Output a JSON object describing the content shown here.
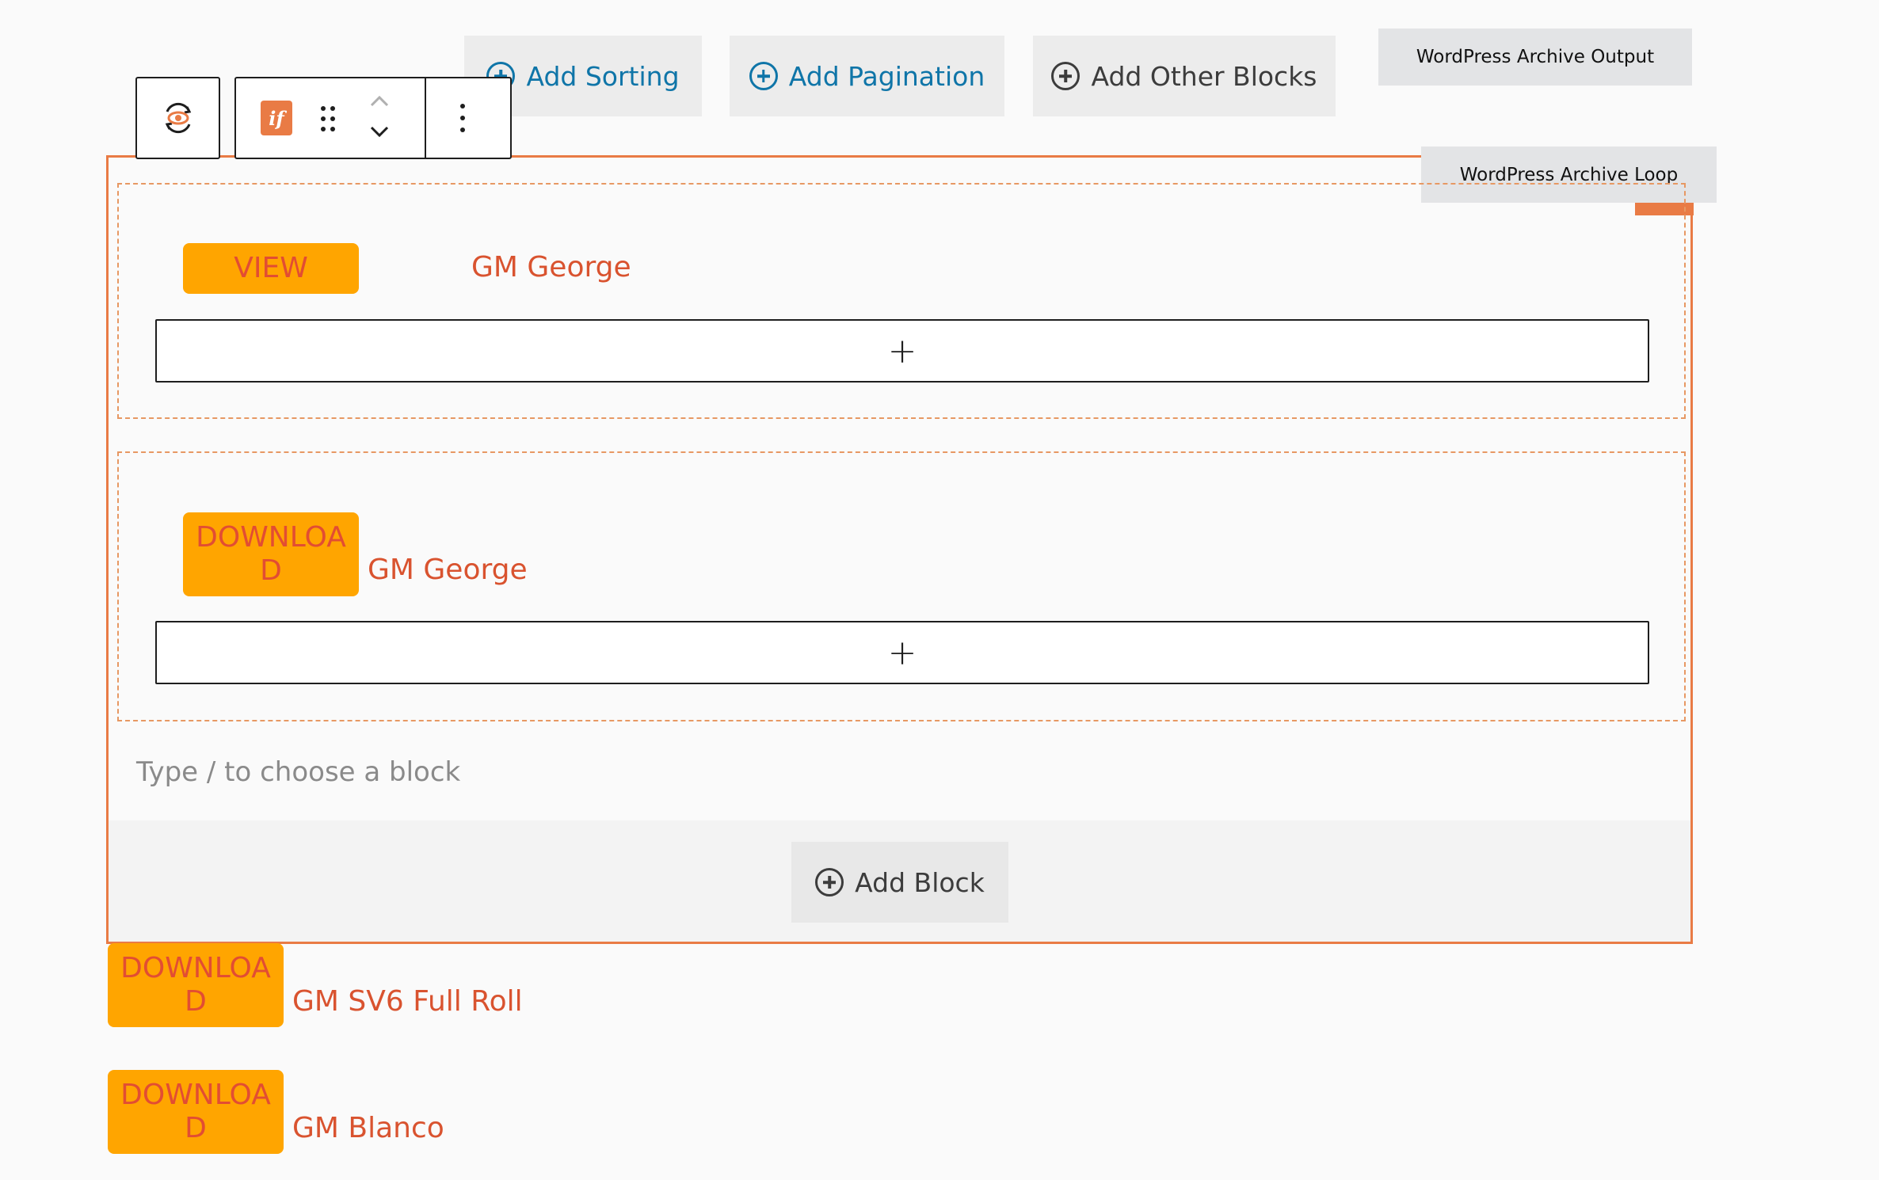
{
  "top_buttons": {
    "add_sorting": "Add Sorting",
    "add_pagination": "Add Pagination",
    "add_other_blocks": "Add Other Blocks"
  },
  "tags": {
    "archive_output": "WordPress Archive Output",
    "archive_loop": "WordPress Archive Loop"
  },
  "block_toolbar": {
    "conditional_icon_text": "if"
  },
  "loop_items": [
    {
      "button": "VIEW",
      "title": "GM George",
      "appender": "+"
    },
    {
      "button": "DOWNLOAD",
      "title": "GM George",
      "appender": "+"
    }
  ],
  "placeholder": "Type / to choose a block",
  "add_block": "Add Block",
  "output_items": [
    {
      "button": "DOWNLOAD",
      "title": "GM SV6 Full Roll"
    },
    {
      "button": "DOWNLOAD",
      "title": "GM Blanco"
    }
  ],
  "colors": {
    "accent_orange": "#e97b45",
    "button_orange": "#ffa500",
    "text_red": "#d9532f",
    "link_blue": "#0f75a8"
  }
}
